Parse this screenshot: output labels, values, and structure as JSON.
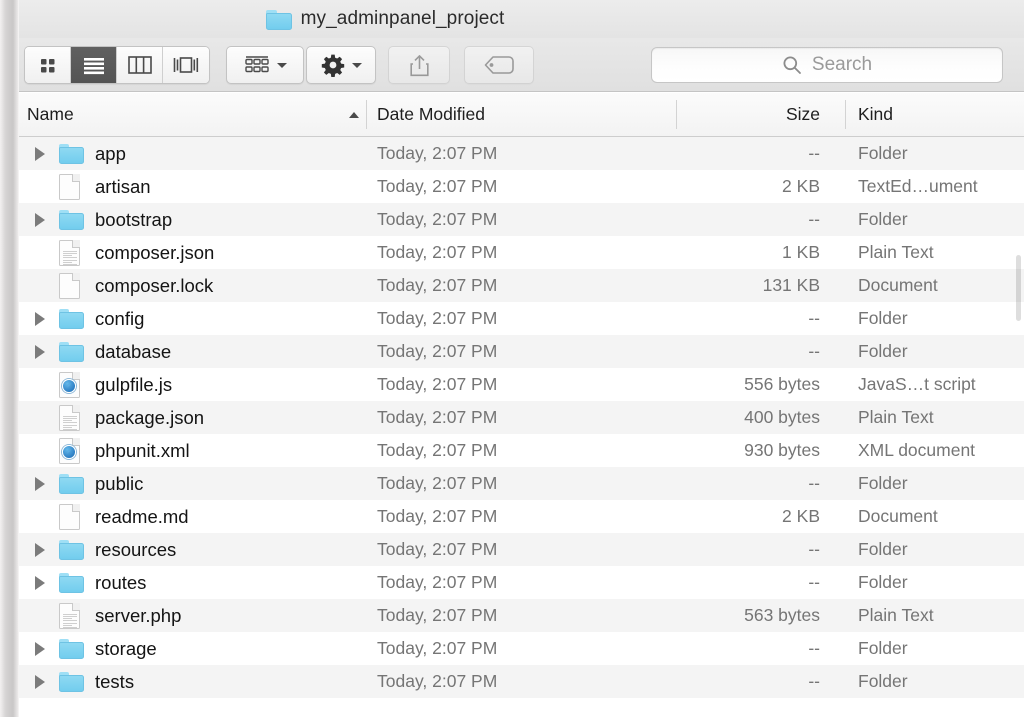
{
  "window": {
    "title": "my_adminpanel_project",
    "title_icon": "folder-icon"
  },
  "toolbar": {
    "view_buttons": [
      {
        "name": "icon-view-button",
        "icon": "grid-icon",
        "selected": false
      },
      {
        "name": "list-view-button",
        "icon": "list-icon",
        "selected": true
      },
      {
        "name": "column-view-button",
        "icon": "columns-icon",
        "selected": false
      },
      {
        "name": "gallery-view-button",
        "icon": "coverflow-icon",
        "selected": false
      }
    ],
    "arrange_button": {
      "name": "arrange-button",
      "icon": "arrange-grid-icon",
      "disabled": false
    },
    "action_button": {
      "name": "action-button",
      "icon": "gear-icon",
      "disabled": false
    },
    "share_button": {
      "name": "share-button",
      "icon": "share-icon",
      "disabled": true
    },
    "tag_button": {
      "name": "tag-button",
      "icon": "tag-icon",
      "disabled": true
    },
    "search": {
      "placeholder": "Search",
      "value": "",
      "icon": "search-icon"
    }
  },
  "columns": {
    "name": {
      "label": "Name",
      "sorted": true,
      "sort_direction": "ascending"
    },
    "date": {
      "label": "Date Modified"
    },
    "size": {
      "label": "Size"
    },
    "kind": {
      "label": "Kind"
    }
  },
  "colors": {
    "folder_blue": "#7fd2ef",
    "row_stripe": "#f4f4f4",
    "selected_button": "#5a5a5a",
    "text_primary": "#141414",
    "text_secondary": "#757575"
  },
  "files": [
    {
      "name": "app",
      "icon": "folder-icon",
      "expandable": true,
      "date": "Today, 2:07 PM",
      "size": "--",
      "kind": "Folder"
    },
    {
      "name": "artisan",
      "icon": "document-icon",
      "expandable": false,
      "date": "Today, 2:07 PM",
      "size": "2 KB",
      "kind": "TextEd…ument"
    },
    {
      "name": "bootstrap",
      "icon": "folder-icon",
      "expandable": true,
      "date": "Today, 2:07 PM",
      "size": "--",
      "kind": "Folder"
    },
    {
      "name": "composer.json",
      "icon": "text-document-icon",
      "expandable": false,
      "date": "Today, 2:07 PM",
      "size": "1 KB",
      "kind": "Plain Text"
    },
    {
      "name": "composer.lock",
      "icon": "document-icon",
      "expandable": false,
      "date": "Today, 2:07 PM",
      "size": "131 KB",
      "kind": "Document"
    },
    {
      "name": "config",
      "icon": "folder-icon",
      "expandable": true,
      "date": "Today, 2:07 PM",
      "size": "--",
      "kind": "Folder"
    },
    {
      "name": "database",
      "icon": "folder-icon",
      "expandable": true,
      "date": "Today, 2:07 PM",
      "size": "--",
      "kind": "Folder"
    },
    {
      "name": "gulpfile.js",
      "icon": "script-document-icon",
      "expandable": false,
      "date": "Today, 2:07 PM",
      "size": "556 bytes",
      "kind": "JavaS…t script"
    },
    {
      "name": "package.json",
      "icon": "text-document-icon",
      "expandable": false,
      "date": "Today, 2:07 PM",
      "size": "400 bytes",
      "kind": "Plain Text"
    },
    {
      "name": "phpunit.xml",
      "icon": "script-document-icon",
      "expandable": false,
      "date": "Today, 2:07 PM",
      "size": "930 bytes",
      "kind": "XML document"
    },
    {
      "name": "public",
      "icon": "folder-icon",
      "expandable": true,
      "date": "Today, 2:07 PM",
      "size": "--",
      "kind": "Folder"
    },
    {
      "name": "readme.md",
      "icon": "document-icon",
      "expandable": false,
      "date": "Today, 2:07 PM",
      "size": "2 KB",
      "kind": "Document"
    },
    {
      "name": "resources",
      "icon": "folder-icon",
      "expandable": true,
      "date": "Today, 2:07 PM",
      "size": "--",
      "kind": "Folder"
    },
    {
      "name": "routes",
      "icon": "folder-icon",
      "expandable": true,
      "date": "Today, 2:07 PM",
      "size": "--",
      "kind": "Folder"
    },
    {
      "name": "server.php",
      "icon": "text-document-icon",
      "expandable": false,
      "date": "Today, 2:07 PM",
      "size": "563 bytes",
      "kind": "Plain Text"
    },
    {
      "name": "storage",
      "icon": "folder-icon",
      "expandable": true,
      "date": "Today, 2:07 PM",
      "size": "--",
      "kind": "Folder"
    },
    {
      "name": "tests",
      "icon": "folder-icon",
      "expandable": true,
      "date": "Today, 2:07 PM",
      "size": "--",
      "kind": "Folder"
    }
  ]
}
